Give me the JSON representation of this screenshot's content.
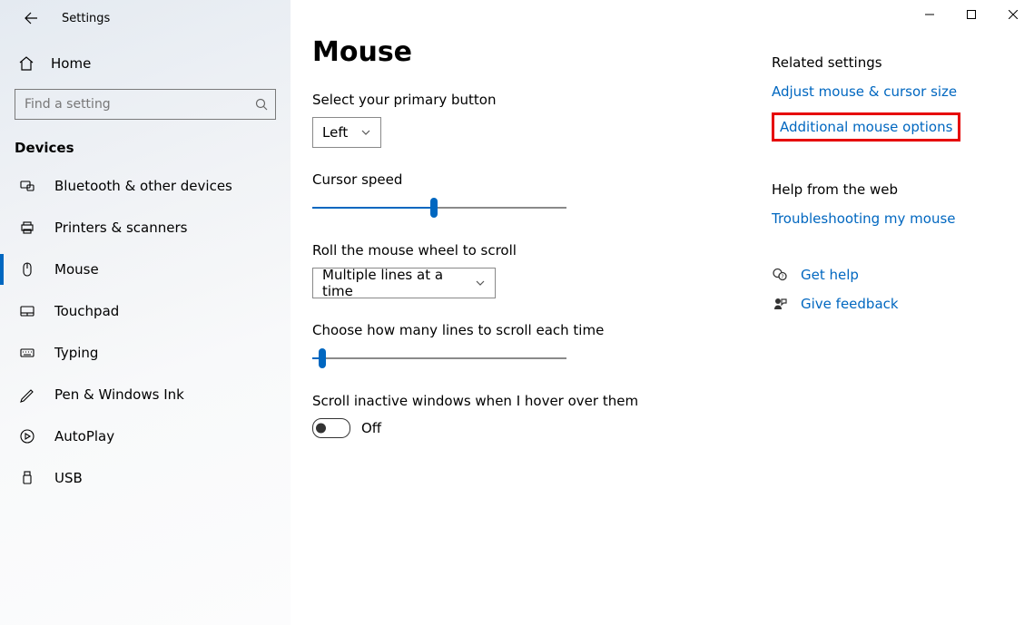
{
  "window": {
    "title": "Settings"
  },
  "sidebar": {
    "home_label": "Home",
    "search_placeholder": "Find a setting",
    "section_title": "Devices",
    "items": [
      {
        "label": "Bluetooth & other devices"
      },
      {
        "label": "Printers & scanners"
      },
      {
        "label": "Mouse"
      },
      {
        "label": "Touchpad"
      },
      {
        "label": "Typing"
      },
      {
        "label": "Pen & Windows Ink"
      },
      {
        "label": "AutoPlay"
      },
      {
        "label": "USB"
      }
    ]
  },
  "page": {
    "title": "Mouse",
    "primary_button": {
      "label": "Select your primary button",
      "value": "Left"
    },
    "cursor_speed": {
      "label": "Cursor speed",
      "percent": 48
    },
    "wheel": {
      "label": "Roll the mouse wheel to scroll",
      "value": "Multiple lines at a time"
    },
    "lines": {
      "label": "Choose how many lines to scroll each time",
      "percent": 4
    },
    "hover": {
      "label": "Scroll inactive windows when I hover over them",
      "state": "Off"
    }
  },
  "related": {
    "title": "Related settings",
    "links": [
      {
        "text": "Adjust mouse & cursor size"
      },
      {
        "text": "Additional mouse options"
      }
    ]
  },
  "webhelp": {
    "title": "Help from the web",
    "links": [
      {
        "text": "Troubleshooting my mouse"
      }
    ]
  },
  "support": {
    "get_help": "Get help",
    "feedback": "Give feedback"
  }
}
